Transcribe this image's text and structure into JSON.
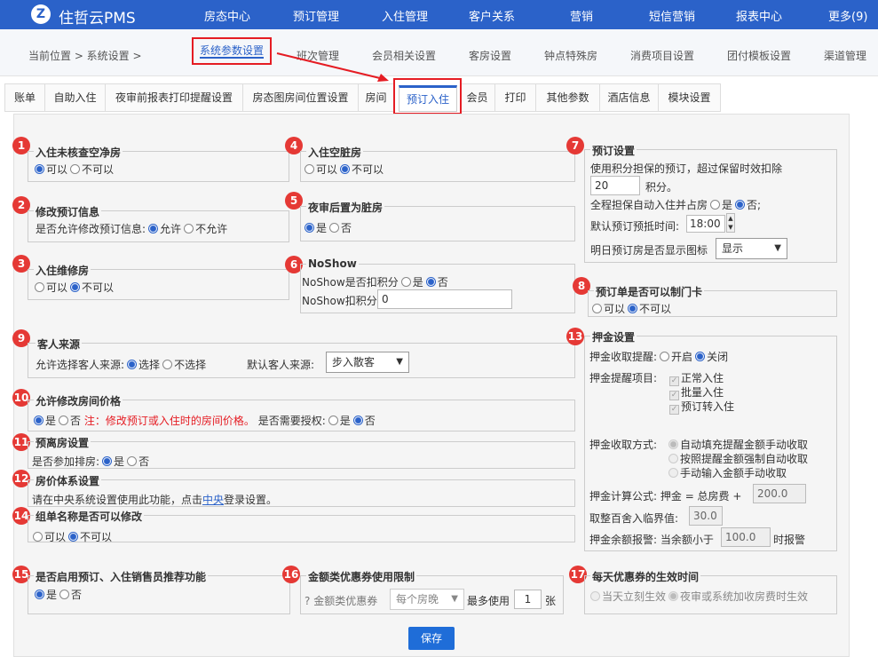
{
  "app": {
    "brand": "住哲云PMS",
    "logo_icon": "logo-icon"
  },
  "nav": [
    "房态中心",
    "预订管理",
    "入住管理",
    "客户关系",
    "营销",
    "短信营销",
    "报表中心",
    "更多(9)"
  ],
  "breadcrumb": "当前位置 > 系统设置 >",
  "subnav": {
    "active": "系统参数设置",
    "items": [
      "班次管理",
      "会员相关设置",
      "客房设置",
      "钟点特殊房",
      "消费项目设置",
      "团付模板设置",
      "渠道管理"
    ]
  },
  "tabs": {
    "items": [
      "账单",
      "自助入住",
      "夜审前报表打印提醒设置",
      "房态图房间位置设置",
      "房间"
    ],
    "active": "预订入住",
    "after": [
      "会员",
      "打印",
      "其他参数",
      "酒店信息",
      "模块设置"
    ]
  },
  "sections": {
    "s1": {
      "num": "1",
      "title": "入住未核查空净房",
      "opt1": "可以",
      "opt2": "不可以"
    },
    "s2": {
      "num": "2",
      "title": "修改预订信息",
      "label": "是否允许修改预订信息:",
      "opt1": "允许",
      "opt2": "不允许"
    },
    "s3": {
      "num": "3",
      "title": "入住维修房",
      "opt1": "可以",
      "opt2": "不可以"
    },
    "s4": {
      "num": "4",
      "title": "入住空脏房",
      "opt1": "可以",
      "opt2": "不可以"
    },
    "s5": {
      "num": "5",
      "title": "夜审后置为脏房",
      "opt1": "是",
      "opt2": "否"
    },
    "s6": {
      "num": "6",
      "title": "NoShow",
      "label": "NoShow是否扣积分",
      "opt1": "是",
      "opt2": "否",
      "points_label": "NoShow扣积分",
      "points_value": "0"
    },
    "s7": {
      "num": "7",
      "title": "预订设置",
      "text1": "使用积分担保的预订，超过保留时效扣除",
      "points": "20",
      "points_unit": "积分。",
      "text2": "全程担保自动入住并占房",
      "opt1": "是",
      "opt2": "否;",
      "time_label": "默认预订预抵时间:",
      "time_value": "18:00",
      "icon_label": "明日预订房是否显示图标",
      "icon_value": "显示"
    },
    "s8": {
      "num": "8",
      "title": "预订单是否可以制门卡",
      "opt1": "可以",
      "opt2": "不可以"
    },
    "s9": {
      "num": "9",
      "title": "客人来源",
      "label": "允许选择客人来源:",
      "opt1": "选择",
      "opt2": "不选择",
      "default_label": "默认客人来源:",
      "default_value": "步入散客"
    },
    "s10": {
      "num": "10",
      "title": "允许修改房间价格",
      "opt1": "是",
      "opt2": "否",
      "note": "注：修改预订或入住时的房间价格。",
      "auth_label": "是否需要授权:",
      "auth_opt1": "是",
      "auth_opt2": "否"
    },
    "s11": {
      "num": "11",
      "title": "预离房设置",
      "label": "是否参加排房:",
      "opt1": "是",
      "opt2": "否"
    },
    "s12": {
      "num": "12",
      "title": "房价体系设置",
      "text_pre": "请在中央系统设置使用此功能，点击",
      "link": "中央",
      "text_post": "登录设置。"
    },
    "s13": {
      "num": "13",
      "title": "押金设置",
      "remind_label": "押金收取提醒:",
      "remind_opt1": "开启",
      "remind_opt2": "关闭",
      "items_label": "押金提醒项目:",
      "items": [
        "正常入住",
        "批量入住",
        "预订转入住"
      ],
      "method_label": "押金收取方式:",
      "methods": [
        "自动填充提醒金额手动收取",
        "按照提醒金额强制自动收取",
        "手动输入金额手动收取"
      ],
      "formula_label": "押金计算公式:",
      "formula_text": "押金 = 总房费 +",
      "formula_value": "200.0",
      "round_label": "取整百舍入临界值:",
      "round_value": "30.0",
      "warn_label": "押金余额报警:",
      "warn_pre": "当余额小于",
      "warn_value": "100.0",
      "warn_post": "时报警"
    },
    "s14": {
      "num": "14",
      "title": "组单名称是否可以修改",
      "opt1": "可以",
      "opt2": "不可以"
    },
    "s15": {
      "num": "15",
      "title": "是否启用预订、入住销售员推荐功能",
      "opt1": "是",
      "opt2": "否"
    },
    "s16": {
      "num": "16",
      "title": "金额类优惠券使用限制",
      "label": "金额类优惠券",
      "select_value": "每个房晚",
      "max_label": "最多使用",
      "max_value": "1",
      "unit": "张"
    },
    "s17": {
      "num": "17",
      "title": "每天优惠券的生效时间",
      "opt1": "当天立刻生效",
      "opt2": "夜审或系统加收房费时生效"
    }
  },
  "save_label": "保存"
}
